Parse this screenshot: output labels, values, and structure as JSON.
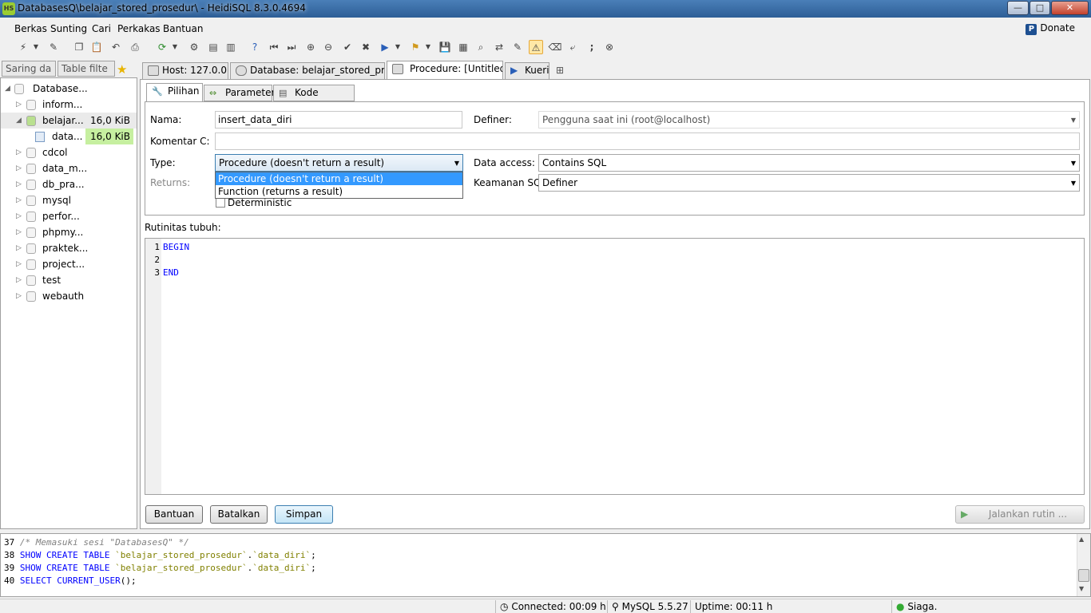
{
  "window": {
    "title": "DatabasesQ\\belajar_stored_prosedur\\ - HeidiSQL 8.3.0.4694",
    "icon_label": "HS",
    "min": "—",
    "max": "□",
    "close": "✕"
  },
  "menu": {
    "items": [
      "Berkas",
      "Sunting",
      "Cari",
      "Perkakas",
      "Bantuan"
    ],
    "donate": "Donate"
  },
  "left": {
    "tabs": [
      "Saring da",
      "Table filte"
    ],
    "tree": [
      {
        "label": "Database...",
        "size": "",
        "level": 0,
        "expanded": true
      },
      {
        "label": "inform...",
        "size": "",
        "level": 1
      },
      {
        "label": "belajar...",
        "size": "16,0 KiB",
        "level": 1,
        "expanded": true
      },
      {
        "label": "data...",
        "size": "16,0 KiB",
        "level": 2
      },
      {
        "label": "cdcol",
        "size": "",
        "level": 1
      },
      {
        "label": "data_m...",
        "size": "",
        "level": 1
      },
      {
        "label": "db_pra...",
        "size": "",
        "level": 1
      },
      {
        "label": "mysql",
        "size": "",
        "level": 1
      },
      {
        "label": "perfor...",
        "size": "",
        "level": 1
      },
      {
        "label": "phpmy...",
        "size": "",
        "level": 1
      },
      {
        "label": "praktek...",
        "size": "",
        "level": 1
      },
      {
        "label": "project...",
        "size": "",
        "level": 1
      },
      {
        "label": "test",
        "size": "",
        "level": 1
      },
      {
        "label": "webauth",
        "size": "",
        "level": 1
      }
    ]
  },
  "tabs": {
    "host": "Host: 127.0.0.1",
    "database": "Database: belajar_stored_pros...",
    "procedure": "Procedure: [Untitled]",
    "query": "Kueri"
  },
  "subtabs": {
    "options": "Pilihan",
    "params": "Parameter",
    "create": "Kode CREATE"
  },
  "form": {
    "name_label": "Nama:",
    "name_value": "insert_data_diri",
    "definer_label": "Definer:",
    "definer_value": "Pengguna saat ini (root@localhost)",
    "comment_label": "Komentar C:",
    "comment_value": "",
    "type_label": "Type:",
    "type_value": "Procedure (doesn't return a result)",
    "type_options": [
      "Procedure (doesn't return a result)",
      "Function (returns a result)"
    ],
    "returns_label": "Returns:",
    "deterministic_label": "Deterministic",
    "data_access_label": "Data access:",
    "data_access_value": "Contains SQL",
    "security_label": "Keamanan SQL",
    "security_value": "Definer"
  },
  "body": {
    "label": "Rutinitas tubuh:",
    "lines": [
      {
        "n": "1",
        "t": "BEGIN"
      },
      {
        "n": "2",
        "t": ""
      },
      {
        "n": "3",
        "t": "END"
      }
    ]
  },
  "buttons": {
    "help": "Bantuan",
    "cancel": "Batalkan",
    "save": "Simpan",
    "run": "Jalankan rutin ..."
  },
  "log": [
    {
      "n": "37",
      "parts": [
        {
          "c": "cm",
          "t": "/* Memasuki sesi \"DatabasesQ\" */"
        }
      ]
    },
    {
      "n": "38",
      "parts": [
        {
          "c": "kw",
          "t": "SHOW CREATE TABLE "
        },
        {
          "c": "str",
          "t": "`belajar_stored_prosedur`"
        },
        {
          "c": "",
          "t": "."
        },
        {
          "c": "str",
          "t": "`data_diri`"
        },
        {
          "c": "",
          "t": ";"
        }
      ]
    },
    {
      "n": "39",
      "parts": [
        {
          "c": "kw",
          "t": "SHOW CREATE TABLE "
        },
        {
          "c": "str",
          "t": "`belajar_stored_prosedur`"
        },
        {
          "c": "",
          "t": "."
        },
        {
          "c": "str",
          "t": "`data_diri`"
        },
        {
          "c": "",
          "t": ";"
        }
      ]
    },
    {
      "n": "40",
      "parts": [
        {
          "c": "kw",
          "t": "SELECT CURRENT_USER"
        },
        {
          "c": "",
          "t": "();"
        }
      ]
    }
  ],
  "status": {
    "connected": "Connected: 00:09 h",
    "version": "MySQL 5.5.27",
    "uptime": "Uptime: 00:11 h",
    "state": "Siaga."
  },
  "colors": {
    "titlebar": "#2d5e96",
    "selection": "#3399ff",
    "size_highlight": "#c6efa0"
  }
}
